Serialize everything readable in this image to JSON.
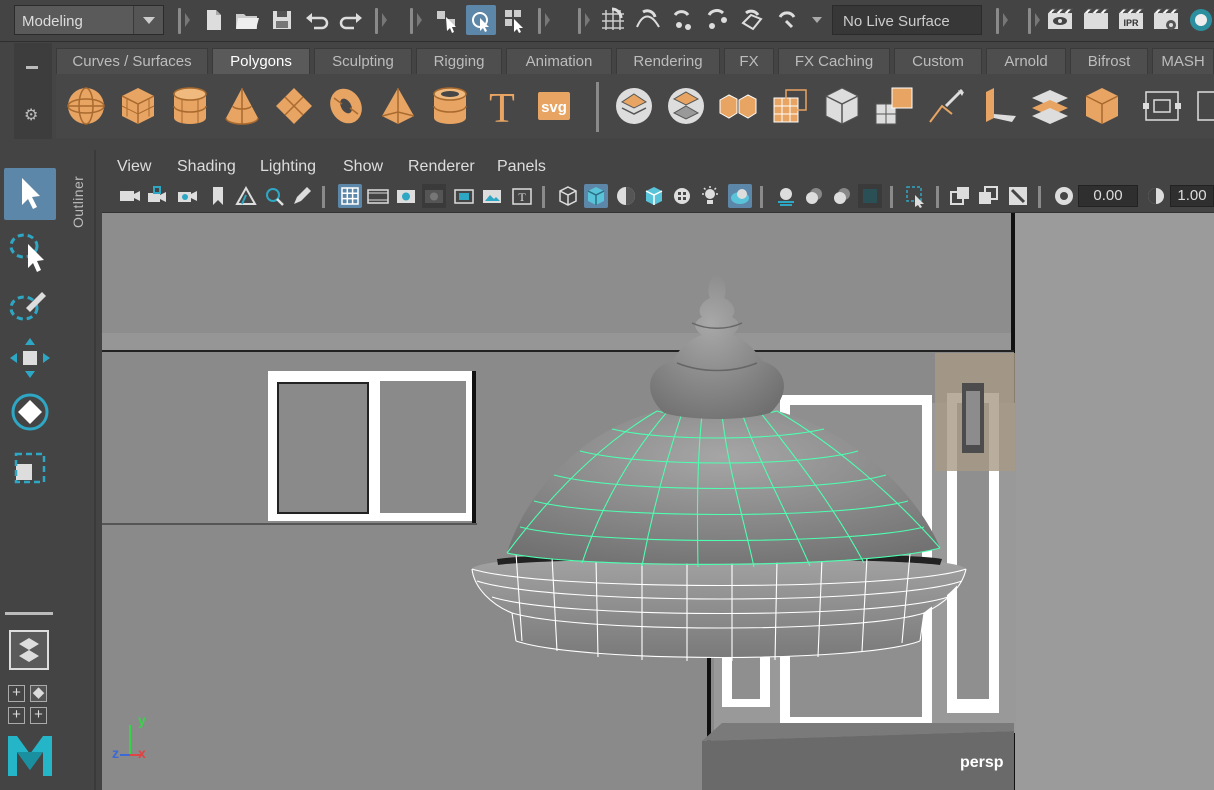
{
  "status_line": {
    "mode": "Modeling",
    "live_surface": "No Live Surface",
    "icons": [
      "new-scene-icon",
      "open-scene-icon",
      "save-scene-icon",
      "undo-icon",
      "redo-icon",
      "select-hierarchy-icon",
      "select-object-icon",
      "select-component-icon",
      "snap-grid-icon",
      "snap-curve-icon",
      "snap-point-icon",
      "snap-view-plane-icon",
      "snap-live-icon",
      "make-live-icon",
      "render-view-icon",
      "render-current-icon",
      "ipr-render-icon",
      "render-settings-icon",
      "hypershade-icon"
    ]
  },
  "shelf": {
    "tabs": [
      "Curves / Surfaces",
      "Polygons",
      "Sculpting",
      "Rigging",
      "Animation",
      "Rendering",
      "FX",
      "FX Caching",
      "Custom",
      "Arnold",
      "Bifrost",
      "MASH"
    ],
    "active_tab": "Polygons",
    "text_tool_label": "T",
    "svg_tool_label": "svg"
  },
  "outliner": {
    "label": "Outliner"
  },
  "panel": {
    "menus": [
      "View",
      "Shading",
      "Lighting",
      "Show",
      "Renderer",
      "Panels"
    ],
    "exposure": "0.00",
    "gamma": "1.00",
    "camera_label": "persp",
    "axis": {
      "x": "x",
      "y": "y",
      "z": "z"
    }
  },
  "colors": {
    "accent": "#5d87a9",
    "shelf_icon": "#e8a462",
    "wireframe_selected": "#4dffb0",
    "viewport_bg": "#888888"
  }
}
